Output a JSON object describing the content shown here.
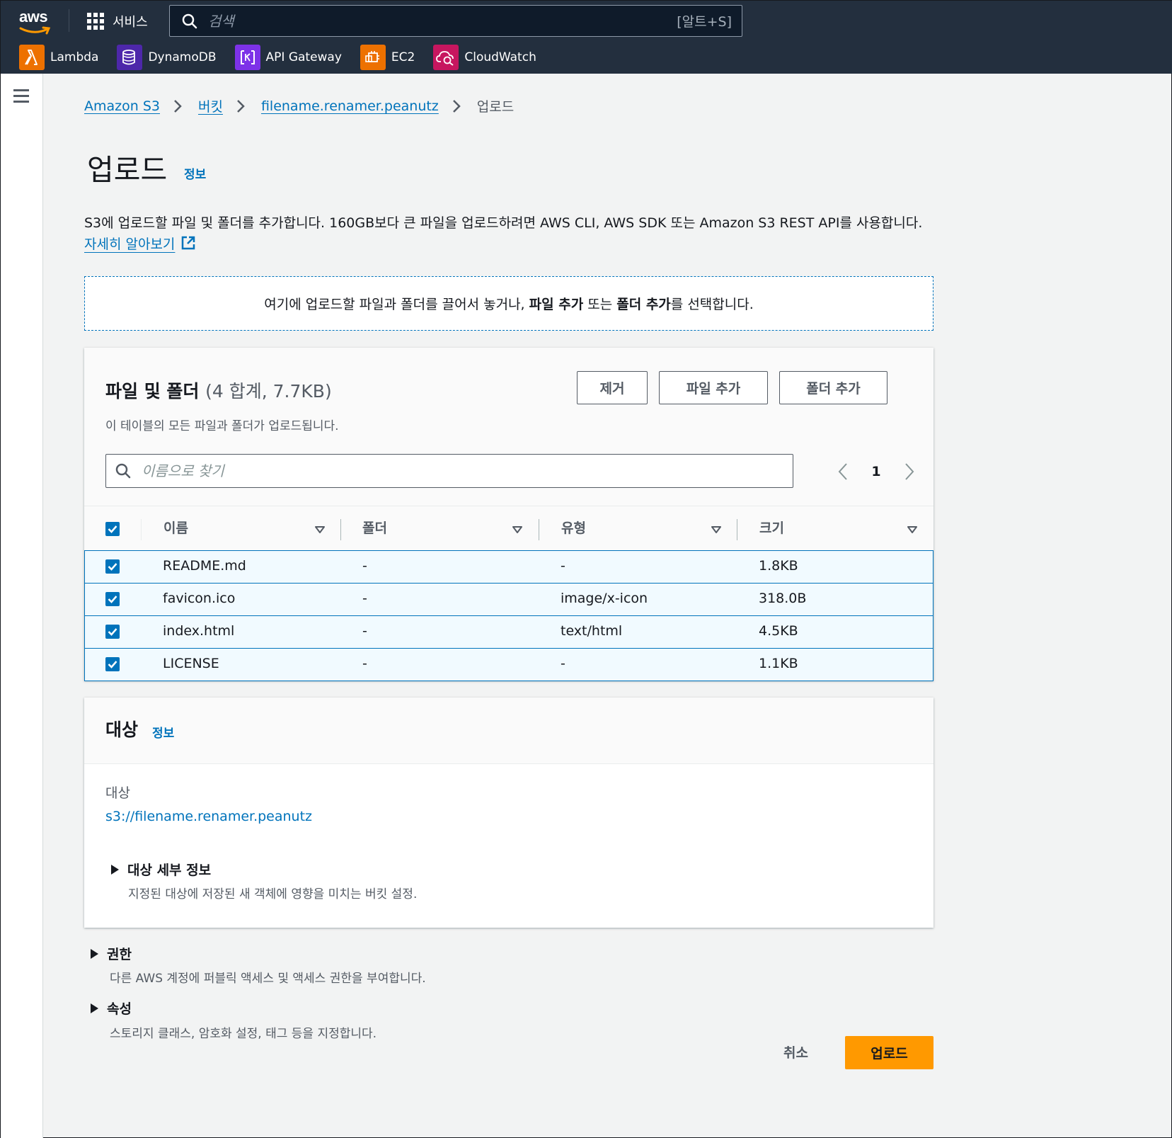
{
  "topbar": {
    "logo_text": "aws",
    "services_label": "서비스",
    "search_placeholder": "검색",
    "search_shortcut": "[알트+S]",
    "favorites": [
      {
        "label": "Lambda",
        "icon": "lambda-icon",
        "color": "#ed7100"
      },
      {
        "label": "DynamoDB",
        "icon": "dynamodb-icon",
        "color": "#4d27aa"
      },
      {
        "label": "API Gateway",
        "icon": "api-gateway-icon",
        "color": "#7d32e8"
      },
      {
        "label": "EC2",
        "icon": "ec2-icon",
        "color": "#ed7100"
      },
      {
        "label": "CloudWatch",
        "icon": "cloudwatch-icon",
        "color": "#c7165f"
      }
    ]
  },
  "breadcrumb": {
    "items": [
      "Amazon S3",
      "버킷",
      "filename.renamer.peanutz"
    ],
    "current": "업로드"
  },
  "page": {
    "title": "업로드",
    "info": "정보",
    "description": "S3에 업로드할 파일 및 폴더를 추가합니다. 160GB보다 큰 파일을 업로드하려면 AWS CLI, AWS SDK 또는 Amazon S3 REST API를 사용합니다.",
    "learn_more": "자세히 알아보기"
  },
  "dropzone": {
    "prefix": "여기에 업로드할 파일과 폴더를 끌어서 놓거나,",
    "add_files": "파일 추가",
    "or": "또는",
    "add_folder": "폴더 추가",
    "suffix": "를 선택합니다."
  },
  "files_panel": {
    "title": "파일 및 폴더",
    "count": "(4 합계, 7.7KB)",
    "subtitle": "이 테이블의 모든 파일과 폴더가 업로드됩니다.",
    "remove_label": "제거",
    "add_files_label": "파일 추가",
    "add_folder_label": "폴더 추가",
    "filter_placeholder": "이름으로 찾기",
    "page_number": "1",
    "columns": [
      "이름",
      "폴더",
      "유형",
      "크기"
    ],
    "rows": [
      {
        "name": "README.md",
        "folder": "-",
        "type": "-",
        "size": "1.8KB"
      },
      {
        "name": "favicon.ico",
        "folder": "-",
        "type": "image/x-icon",
        "size": "318.0B"
      },
      {
        "name": "index.html",
        "folder": "-",
        "type": "text/html",
        "size": "4.5KB"
      },
      {
        "name": "LICENSE",
        "folder": "-",
        "type": "-",
        "size": "1.1KB"
      }
    ]
  },
  "target_panel": {
    "title": "대상",
    "info": "정보",
    "label": "대상",
    "s3_uri": "s3://filename.renamer.peanutz",
    "details_title": "대상 세부 정보",
    "details_sub": "지정된 대상에 저장된 새 객체에 영향을 미치는 버킷 설정."
  },
  "permissions": {
    "title": "권한",
    "sub": "다른 AWS 계정에 퍼블릭 액세스 및 액세스 권한을 부여합니다."
  },
  "properties": {
    "title": "속성",
    "sub": "스토리지 클래스, 암호화 설정, 태그 등을 지정합니다."
  },
  "footer": {
    "cancel_label": "취소",
    "upload_label": "업로드"
  },
  "colors": {
    "nav_bg": "#232f3e",
    "link": "#0073bb",
    "primary": "#ff9900",
    "selected_row": "#f1faff"
  }
}
